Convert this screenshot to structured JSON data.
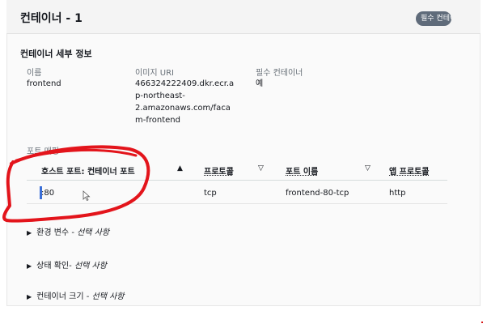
{
  "header": {
    "title": "컨테이너 - 1",
    "badge": "필수 컨테이너"
  },
  "details": {
    "section_title": "컨테이너 세부 정보",
    "name_label": "이름",
    "name_value": "frontend",
    "image_label": "이미지 URI",
    "image_value_lines": [
      "466324222409.dkr.ecr.a",
      "p-northeast-",
      "2.amazonaws.com/faca",
      "m-frontend"
    ],
    "essential_label": "필수 컨테이너",
    "essential_value": "예"
  },
  "port_mapping": {
    "label": "포트 매핑",
    "columns": [
      "호스트 포트: 컨테이너 포트",
      "프로토콜",
      "포트 이름",
      "앱 프로토콜"
    ],
    "sort_icons": [
      "▲",
      "▽",
      "▽"
    ],
    "rows": [
      {
        "port": ":80",
        "protocol": "tcp",
        "port_name": "frontend-80-tcp",
        "app_protocol": "http"
      }
    ]
  },
  "expanders": [
    {
      "label": "환경 변수 - ",
      "optional": "선택 사항"
    },
    {
      "label": "상태 확인- ",
      "optional": "선택 사항"
    },
    {
      "label": "컨테이너 크기 - ",
      "optional": "선택 사항"
    }
  ],
  "colors": {
    "annotation": "#e3141b",
    "text_cursor": "#3a6fd8"
  }
}
